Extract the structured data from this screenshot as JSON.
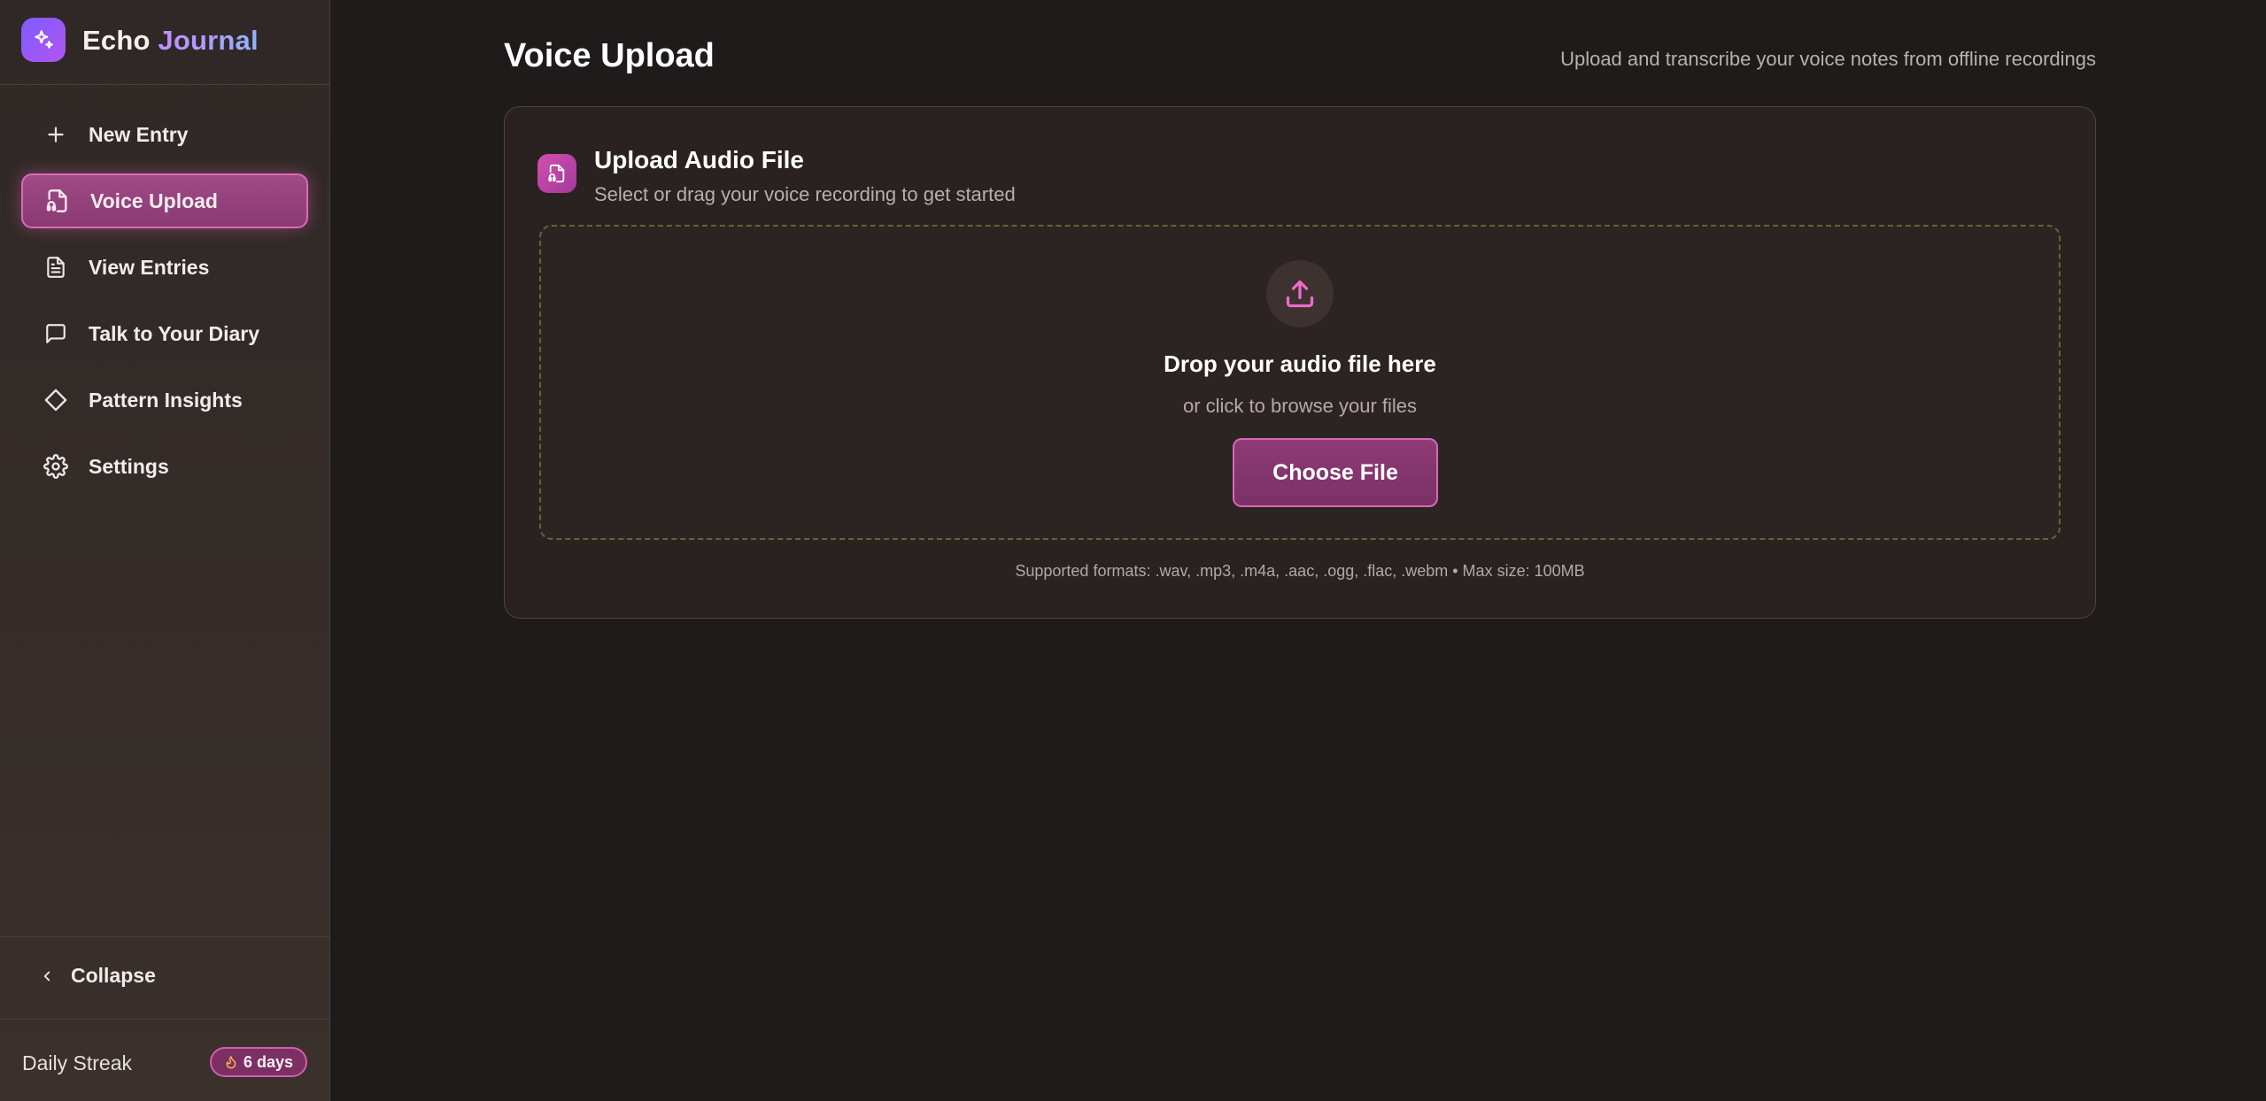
{
  "app": {
    "name_part1": "Echo",
    "name_part2": "Journal",
    "logo_icon": "sparkles-icon"
  },
  "sidebar": {
    "items": [
      {
        "label": "New Entry",
        "icon": "plus-icon",
        "active": false
      },
      {
        "label": "Voice Upload",
        "icon": "file-audio-icon",
        "active": true
      },
      {
        "label": "View Entries",
        "icon": "file-text-icon",
        "active": false
      },
      {
        "label": "Talk to Your Diary",
        "icon": "message-square-icon",
        "active": false
      },
      {
        "label": "Pattern Insights",
        "icon": "diamond-icon",
        "active": false
      },
      {
        "label": "Settings",
        "icon": "gear-icon",
        "active": false
      }
    ],
    "collapse_label": "Collapse",
    "streak_label": "Daily Streak",
    "streak_value": "6 days"
  },
  "header": {
    "title": "Voice Upload",
    "subtitle": "Upload and transcribe your voice notes from offline recordings"
  },
  "upload_card": {
    "title": "Upload Audio File",
    "subtitle": "Select or drag your voice recording to get started",
    "drop_title": "Drop your audio file here",
    "drop_subtitle": "or click to browse your files",
    "button_label": "Choose File",
    "formats_note": "Supported formats: .wav, .mp3, .m4a, .aac, .ogg, .flac, .webm • Max size: 100MB"
  },
  "colors": {
    "background": "#1f1b1b",
    "sidebar": "#2f2826",
    "accent": "#d768b4",
    "accent_fill": "#8e3b76",
    "logo_gradient_start": "#7c5cff",
    "dashed_border": "#6e5f3b"
  }
}
